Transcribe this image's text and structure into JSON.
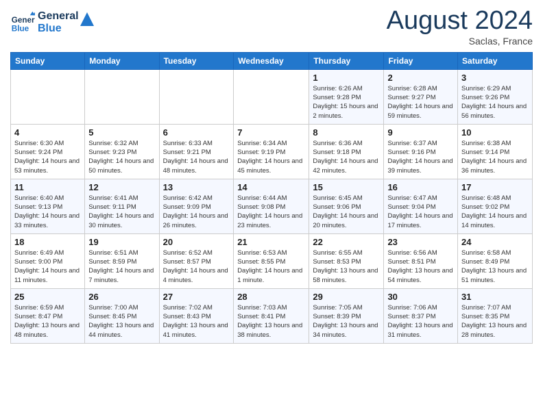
{
  "header": {
    "logo_line1": "General",
    "logo_line2": "Blue",
    "month_year": "August 2024",
    "location": "Saclas, France"
  },
  "days_of_week": [
    "Sunday",
    "Monday",
    "Tuesday",
    "Wednesday",
    "Thursday",
    "Friday",
    "Saturday"
  ],
  "weeks": [
    [
      {
        "day": "",
        "sunrise": "",
        "sunset": "",
        "daylight": ""
      },
      {
        "day": "",
        "sunrise": "",
        "sunset": "",
        "daylight": ""
      },
      {
        "day": "",
        "sunrise": "",
        "sunset": "",
        "daylight": ""
      },
      {
        "day": "",
        "sunrise": "",
        "sunset": "",
        "daylight": ""
      },
      {
        "day": "1",
        "sunrise": "Sunrise: 6:26 AM",
        "sunset": "Sunset: 9:28 PM",
        "daylight": "Daylight: 15 hours and 2 minutes."
      },
      {
        "day": "2",
        "sunrise": "Sunrise: 6:28 AM",
        "sunset": "Sunset: 9:27 PM",
        "daylight": "Daylight: 14 hours and 59 minutes."
      },
      {
        "day": "3",
        "sunrise": "Sunrise: 6:29 AM",
        "sunset": "Sunset: 9:26 PM",
        "daylight": "Daylight: 14 hours and 56 minutes."
      }
    ],
    [
      {
        "day": "4",
        "sunrise": "Sunrise: 6:30 AM",
        "sunset": "Sunset: 9:24 PM",
        "daylight": "Daylight: 14 hours and 53 minutes."
      },
      {
        "day": "5",
        "sunrise": "Sunrise: 6:32 AM",
        "sunset": "Sunset: 9:23 PM",
        "daylight": "Daylight: 14 hours and 50 minutes."
      },
      {
        "day": "6",
        "sunrise": "Sunrise: 6:33 AM",
        "sunset": "Sunset: 9:21 PM",
        "daylight": "Daylight: 14 hours and 48 minutes."
      },
      {
        "day": "7",
        "sunrise": "Sunrise: 6:34 AM",
        "sunset": "Sunset: 9:19 PM",
        "daylight": "Daylight: 14 hours and 45 minutes."
      },
      {
        "day": "8",
        "sunrise": "Sunrise: 6:36 AM",
        "sunset": "Sunset: 9:18 PM",
        "daylight": "Daylight: 14 hours and 42 minutes."
      },
      {
        "day": "9",
        "sunrise": "Sunrise: 6:37 AM",
        "sunset": "Sunset: 9:16 PM",
        "daylight": "Daylight: 14 hours and 39 minutes."
      },
      {
        "day": "10",
        "sunrise": "Sunrise: 6:38 AM",
        "sunset": "Sunset: 9:14 PM",
        "daylight": "Daylight: 14 hours and 36 minutes."
      }
    ],
    [
      {
        "day": "11",
        "sunrise": "Sunrise: 6:40 AM",
        "sunset": "Sunset: 9:13 PM",
        "daylight": "Daylight: 14 hours and 33 minutes."
      },
      {
        "day": "12",
        "sunrise": "Sunrise: 6:41 AM",
        "sunset": "Sunset: 9:11 PM",
        "daylight": "Daylight: 14 hours and 30 minutes."
      },
      {
        "day": "13",
        "sunrise": "Sunrise: 6:42 AM",
        "sunset": "Sunset: 9:09 PM",
        "daylight": "Daylight: 14 hours and 26 minutes."
      },
      {
        "day": "14",
        "sunrise": "Sunrise: 6:44 AM",
        "sunset": "Sunset: 9:08 PM",
        "daylight": "Daylight: 14 hours and 23 minutes."
      },
      {
        "day": "15",
        "sunrise": "Sunrise: 6:45 AM",
        "sunset": "Sunset: 9:06 PM",
        "daylight": "Daylight: 14 hours and 20 minutes."
      },
      {
        "day": "16",
        "sunrise": "Sunrise: 6:47 AM",
        "sunset": "Sunset: 9:04 PM",
        "daylight": "Daylight: 14 hours and 17 minutes."
      },
      {
        "day": "17",
        "sunrise": "Sunrise: 6:48 AM",
        "sunset": "Sunset: 9:02 PM",
        "daylight": "Daylight: 14 hours and 14 minutes."
      }
    ],
    [
      {
        "day": "18",
        "sunrise": "Sunrise: 6:49 AM",
        "sunset": "Sunset: 9:00 PM",
        "daylight": "Daylight: 14 hours and 11 minutes."
      },
      {
        "day": "19",
        "sunrise": "Sunrise: 6:51 AM",
        "sunset": "Sunset: 8:59 PM",
        "daylight": "Daylight: 14 hours and 7 minutes."
      },
      {
        "day": "20",
        "sunrise": "Sunrise: 6:52 AM",
        "sunset": "Sunset: 8:57 PM",
        "daylight": "Daylight: 14 hours and 4 minutes."
      },
      {
        "day": "21",
        "sunrise": "Sunrise: 6:53 AM",
        "sunset": "Sunset: 8:55 PM",
        "daylight": "Daylight: 14 hours and 1 minute."
      },
      {
        "day": "22",
        "sunrise": "Sunrise: 6:55 AM",
        "sunset": "Sunset: 8:53 PM",
        "daylight": "Daylight: 13 hours and 58 minutes."
      },
      {
        "day": "23",
        "sunrise": "Sunrise: 6:56 AM",
        "sunset": "Sunset: 8:51 PM",
        "daylight": "Daylight: 13 hours and 54 minutes."
      },
      {
        "day": "24",
        "sunrise": "Sunrise: 6:58 AM",
        "sunset": "Sunset: 8:49 PM",
        "daylight": "Daylight: 13 hours and 51 minutes."
      }
    ],
    [
      {
        "day": "25",
        "sunrise": "Sunrise: 6:59 AM",
        "sunset": "Sunset: 8:47 PM",
        "daylight": "Daylight: 13 hours and 48 minutes."
      },
      {
        "day": "26",
        "sunrise": "Sunrise: 7:00 AM",
        "sunset": "Sunset: 8:45 PM",
        "daylight": "Daylight: 13 hours and 44 minutes."
      },
      {
        "day": "27",
        "sunrise": "Sunrise: 7:02 AM",
        "sunset": "Sunset: 8:43 PM",
        "daylight": "Daylight: 13 hours and 41 minutes."
      },
      {
        "day": "28",
        "sunrise": "Sunrise: 7:03 AM",
        "sunset": "Sunset: 8:41 PM",
        "daylight": "Daylight: 13 hours and 38 minutes."
      },
      {
        "day": "29",
        "sunrise": "Sunrise: 7:05 AM",
        "sunset": "Sunset: 8:39 PM",
        "daylight": "Daylight: 13 hours and 34 minutes."
      },
      {
        "day": "30",
        "sunrise": "Sunrise: 7:06 AM",
        "sunset": "Sunset: 8:37 PM",
        "daylight": "Daylight: 13 hours and 31 minutes."
      },
      {
        "day": "31",
        "sunrise": "Sunrise: 7:07 AM",
        "sunset": "Sunset: 8:35 PM",
        "daylight": "Daylight: 13 hours and 28 minutes."
      }
    ]
  ]
}
